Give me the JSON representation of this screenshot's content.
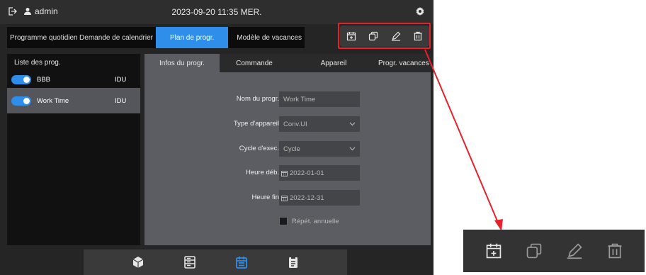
{
  "header": {
    "user": "admin",
    "datetime": "2023-09-20 11:35 MER.",
    "icons": [
      "logout-icon",
      "user-icon",
      "gear-icon"
    ]
  },
  "tabs": [
    {
      "label": "Programme quotidien",
      "active": false
    },
    {
      "label": "Demande de calendrier",
      "active": false
    },
    {
      "label": "Plan de progr.",
      "active": true
    },
    {
      "label": "Modèle de vacances",
      "active": false
    }
  ],
  "toolbar": {
    "icons": [
      "calendar-add-icon",
      "copy-icon",
      "edit-icon",
      "delete-icon"
    ]
  },
  "sidebar": {
    "title": "Liste des prog.",
    "items": [
      {
        "name": "BBB",
        "type": "IDU",
        "enabled": true,
        "selected": false
      },
      {
        "name": "Work Time",
        "type": "IDU",
        "enabled": true,
        "selected": true
      }
    ]
  },
  "panel": {
    "tabs": [
      {
        "label": "Infos du progr.",
        "active": true
      },
      {
        "label": "Commande",
        "active": false
      },
      {
        "label": "Appareil",
        "active": false
      },
      {
        "label": "Progr. vacances",
        "active": false
      }
    ],
    "fields": {
      "name_label": "Nom du progr.",
      "name_value": "Work Time",
      "device_type_label": "Type d'appareil",
      "device_type_value": "Conv.UI",
      "cycle_label": "Cycle d'exec.",
      "cycle_value": "Cycle",
      "start_label": "Heure déb.",
      "start_value": "2022-01-01",
      "end_label": "Heure fin",
      "end_value": "2022-12-31",
      "repeat_label": "Répét. annuelle",
      "repeat_checked": false
    }
  },
  "bottom_nav": {
    "icons": [
      "cube-icon",
      "list-icon",
      "calendar-icon",
      "clipboard-icon"
    ],
    "active_index": 2
  },
  "colors": {
    "accent": "#2f8ee9",
    "highlight": "#e8202a"
  }
}
